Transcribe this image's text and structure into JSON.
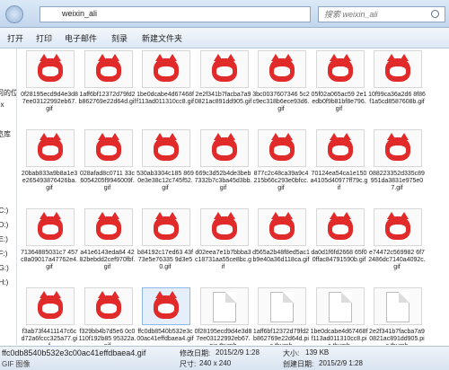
{
  "window": {
    "path": "weixin_ali",
    "search_placeholder": "搜索 weixin_ali"
  },
  "toolbar": {
    "open": "打开",
    "print": "打印",
    "email": "电子邮件",
    "burn": "刻录",
    "new_folder": "新建文件夹"
  },
  "sidebar": {
    "items": [
      "问的位置",
      "ox",
      "览库",
      "(C:)",
      "(D:)",
      "(E:)",
      "(F:)",
      "(G:)",
      "(H:)"
    ]
  },
  "files": [
    {
      "name": "0f28195ecd9d4e3d87ee03122992eb67.gif",
      "kind": "fox"
    },
    {
      "name": "1aff6bf12372d79fd2b862769e22d64d.gif",
      "kind": "fox"
    },
    {
      "name": "1be0dcabe4d67468ff113ad011310cc8.gif",
      "kind": "fox"
    },
    {
      "name": "2e2f341b7facba7a90821ac891dd905.gif",
      "kind": "fox"
    },
    {
      "name": "3bc0037607346 5c2c9ec318b6ece93d6.gif",
      "kind": "fox"
    },
    {
      "name": "05f02a065ac59 2e1edb0f9b81bf8e796.gif",
      "kind": "fox"
    },
    {
      "name": "10f99ca36a2d6 8f86f1a5cd8587608b.gif",
      "kind": "fox"
    },
    {
      "name": "20bab833a9b8a1e3e265493876426ba.gif",
      "kind": "fox"
    },
    {
      "name": "028afad8c0711 33c6054205f9946009f.gif",
      "kind": "fox"
    },
    {
      "name": "530ab3304c185 8690e3e38c12c745f52.gif",
      "kind": "fox"
    },
    {
      "name": "669c3d52b4de3beb7332b7c3ba45d3bb.gif",
      "kind": "fox"
    },
    {
      "name": "877c2c48ca39a9c4215b66c293e0bfcc.gif",
      "kind": "fox"
    },
    {
      "name": "70124ea54ca1e150a4105d40977ff79c.gif",
      "kind": "fox"
    },
    {
      "name": "088223352d335c89951da3831e975e07.gif",
      "kind": "fox"
    },
    {
      "name": "71364885031c7 457c8a09017a47762e4.gif",
      "kind": "fox"
    },
    {
      "name": "a41e6143eda84 4282bebdd2cef970fbf.gif",
      "kind": "fox"
    },
    {
      "name": "b84192c17ed63 43f73e5e76335 9d3e50.gif",
      "kind": "fox"
    },
    {
      "name": "d02eea7e1b7bbba3c18731aa55ce8bc.gif",
      "kind": "fox"
    },
    {
      "name": "d565a2b48f8ed5ac1b9e40a36d118ca.gif",
      "kind": "fox"
    },
    {
      "name": "da0d1f6fd2668 65f00ffac84791590b.gif",
      "kind": "fox"
    },
    {
      "name": "e74472c569982 6f72486dc7140a4092c.gif",
      "kind": "fox"
    },
    {
      "name": "f3ab73f4411147c6cd72a6fccc325a77.gif",
      "kind": "fox"
    },
    {
      "name": "f329bb4b7d5e6 0c0110f192b85 95322a.gif",
      "kind": "fox"
    },
    {
      "name": "ffc0db8540b532e3c00ac41effdbaea4.gif",
      "kind": "fox"
    },
    {
      "name": "0f28195ecd9d4e3d87ee03122992eb67.pic.thumb",
      "kind": "doc"
    },
    {
      "name": "1aff6bf12372d79fd2b862769e22d64d.pic.thumb",
      "kind": "doc"
    },
    {
      "name": "1be0dcabe4d67468ff113ad011310cc8.pic.thumb",
      "kind": "doc"
    },
    {
      "name": "2e2f341b7facba7a90821ac891dd905.pic.thumb",
      "kind": "doc"
    }
  ],
  "status": {
    "name": "ffc0db8540b532e3c00ac41effdbaea4.gif",
    "type": "GIF 图像",
    "modified_label": "修改日期:",
    "modified": "2015/2/9 1:28",
    "created_label": "创建日期:",
    "created": "2015/2/9 1:28",
    "size_label": "大小:",
    "size": "139 KB",
    "dims_label": "尺寸:",
    "dims": "240 x 240"
  }
}
